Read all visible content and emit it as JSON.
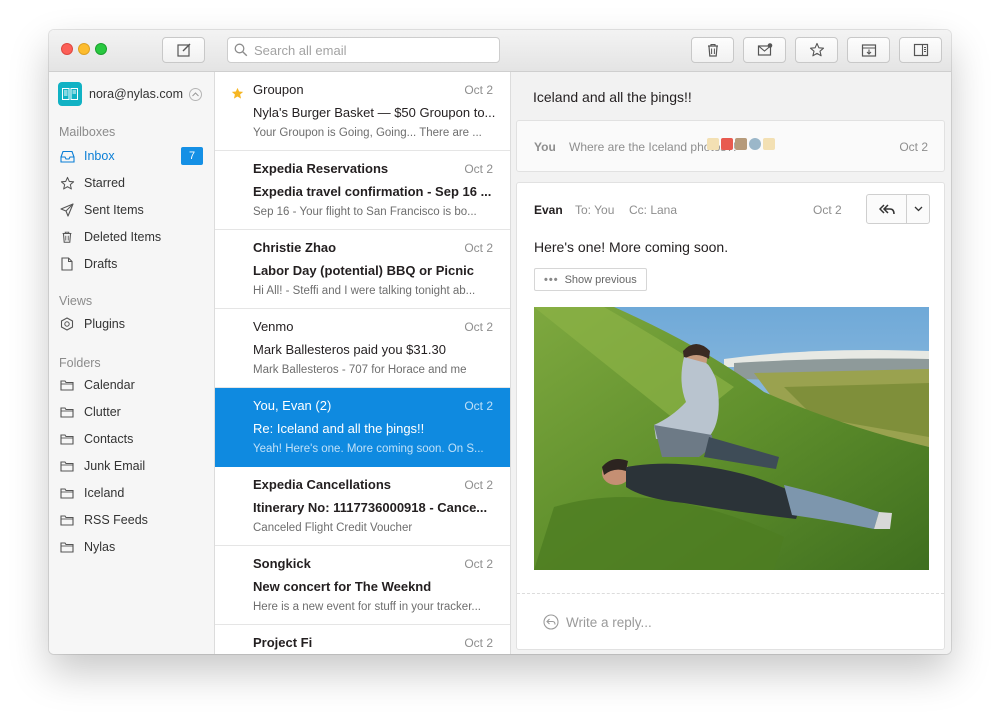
{
  "toolbar": {
    "search_placeholder": "Search all email",
    "buttons": [
      "compose-icon",
      "trash-icon",
      "mark-unread-icon",
      "star-icon",
      "archive-icon",
      "sidebar-toggle-icon"
    ]
  },
  "account": {
    "email": "nora@nylas.com"
  },
  "sidebar": {
    "mailboxes_heading": "Mailboxes",
    "mailboxes": [
      {
        "label": "Inbox",
        "icon": "inbox-icon",
        "count": "7"
      },
      {
        "label": "Starred",
        "icon": "star-icon"
      },
      {
        "label": "Sent Items",
        "icon": "send-icon"
      },
      {
        "label": "Deleted Items",
        "icon": "trash-icon"
      },
      {
        "label": "Drafts",
        "icon": "draft-icon"
      }
    ],
    "views_heading": "Views",
    "views": [
      {
        "label": "Plugins",
        "icon": "plugins-icon"
      }
    ],
    "folders_heading": "Folders",
    "folders": [
      {
        "label": "Calendar"
      },
      {
        "label": "Clutter"
      },
      {
        "label": "Contacts"
      },
      {
        "label": "Junk Email"
      },
      {
        "label": "Iceland"
      },
      {
        "label": "RSS Feeds"
      },
      {
        "label": "Nylas"
      }
    ]
  },
  "threads": [
    {
      "from": "Groupon",
      "date": "Oct 2",
      "subject": "Nyla's Burger Basket — $50 Groupon to...",
      "snippet": "Your Groupon is Going, Going... There are ...",
      "marker": "star"
    },
    {
      "from": "Expedia Reservations",
      "date": "Oct 2",
      "subject": "Expedia travel confirmation - Sep 16 ...",
      "snippet": "Sep 16 - Your flight to San Francisco is bo...",
      "marker": "unread"
    },
    {
      "from": "Christie Zhao",
      "date": "Oct 2",
      "subject": "Labor Day (potential) BBQ or Picnic",
      "snippet": "Hi All! - Steffi and I were talking tonight ab...",
      "marker": "unread"
    },
    {
      "from": "Venmo",
      "date": "Oct 2",
      "subject": "Mark Ballesteros paid you $31.30",
      "snippet": "Mark Ballesteros - 707 for Horace and me",
      "marker": "none"
    },
    {
      "from": "You, Evan (2)",
      "date": "Oct 2",
      "subject": "Re: Iceland and all the þings!!",
      "snippet": "Yeah! Here's one. More coming soon. On S...",
      "marker": "selected"
    },
    {
      "from": "Expedia Cancellations",
      "date": "Oct 2",
      "subject": "Itinerary No: 1117736000918 - Cance...",
      "snippet": "Canceled Flight Credit Voucher",
      "marker": "unread"
    },
    {
      "from": "Songkick",
      "date": "Oct 2",
      "subject": "New concert for The Weeknd",
      "snippet": "Here is a new event for stuff in your tracker...",
      "marker": "unread"
    },
    {
      "from": "Project Fi",
      "date": "Oct 2",
      "subject": "",
      "snippet": "",
      "marker": "unread"
    }
  ],
  "reader": {
    "title": "Iceland and all the þings!!",
    "collapsed": {
      "from": "You",
      "snippet": "Where are the Iceland photos?!",
      "date": "Oct 2"
    },
    "message": {
      "from": "Evan",
      "to": "To: You",
      "cc": "Cc: Lana",
      "date": "Oct 2",
      "body": "Here's one! More coming soon.",
      "show_previous": "Show previous",
      "show_previous_dots": "•••"
    },
    "reply_placeholder": "Write a reply..."
  },
  "colors": {
    "accent": "#1590e5",
    "selected_row": "#0f8ae0",
    "sidebar_bg": "#f6f6f6",
    "reader_bg": "#f2f2f2"
  }
}
